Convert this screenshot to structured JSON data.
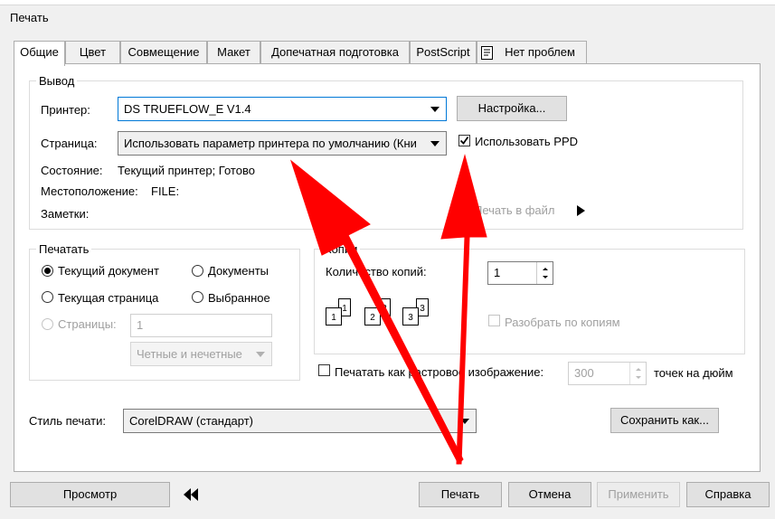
{
  "window": {
    "title": "Печать"
  },
  "tabs": [
    {
      "label": "Общие"
    },
    {
      "label": "Цвет"
    },
    {
      "label": "Совмещение"
    },
    {
      "label": "Макет"
    },
    {
      "label": "Допечатная подготовка"
    },
    {
      "label": "PostScript"
    },
    {
      "label": "Нет проблем",
      "icon": "checklist-icon"
    }
  ],
  "output": {
    "group_label": "Вывод",
    "printer_label": "Принтер:",
    "printer_value": "DS TRUEFLOW_E V1.4",
    "settings_button": "Настройка...",
    "page_label": "Страница:",
    "page_value": "Использовать параметр принтера по умолчанию (Кни",
    "use_ppd_label": "Использовать PPD",
    "use_ppd_checked": true,
    "status_label": "Состояние:",
    "status_value": "Текущий принтер; Готово",
    "location_label": "Местоположение:",
    "location_value": "FILE:",
    "notes_label": "Заметки:",
    "print_to_file_label": "Печать в файл"
  },
  "print_range": {
    "group_label": "Печатать",
    "current_document": "Текущий документ",
    "documents": "Документы",
    "current_page": "Текущая страница",
    "selection": "Выбранное",
    "pages": "Страницы:",
    "pages_value": "1",
    "even_odd": "Четные и нечетные"
  },
  "copies": {
    "group_label": "Копии",
    "count_label": "Количество копий:",
    "count_value": "1",
    "collate_label": "Разобрать по копиям",
    "icon_numbers": [
      "1",
      "1",
      "2",
      "2",
      "3",
      "3"
    ]
  },
  "raster": {
    "label": "Печатать как растровое изображение:",
    "dpi_value": "300",
    "dpi_unit": "точек на дюйм"
  },
  "style": {
    "label": "Стиль печати:",
    "value": "CorelDRAW (стандарт)",
    "save_as_button": "Сохранить как..."
  },
  "footer": {
    "preview_button": "Просмотр",
    "print_button": "Печать",
    "cancel_button": "Отмена",
    "apply_button": "Применить",
    "help_button": "Справка"
  },
  "annotation": {
    "arrow_color": "#ff0000"
  }
}
